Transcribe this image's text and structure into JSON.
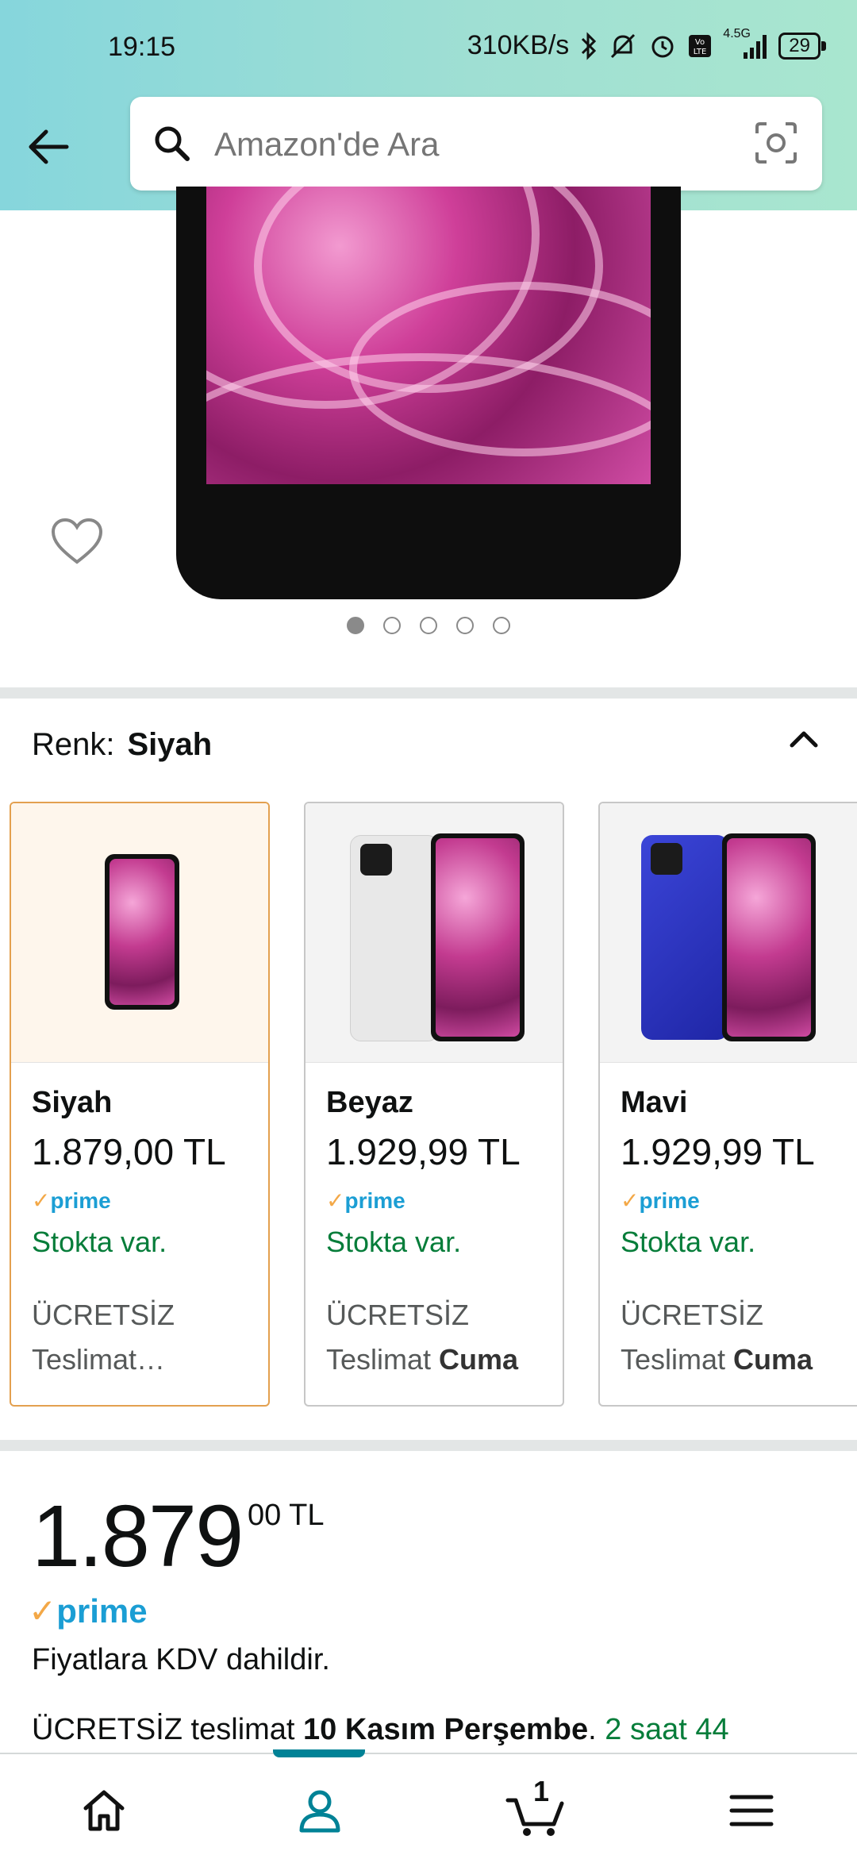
{
  "status_bar": {
    "time": "19:15",
    "network_speed": "310KB/s",
    "network_type": "4.5G",
    "battery": "29"
  },
  "search": {
    "placeholder": "Amazon'de Ara"
  },
  "gallery": {
    "image_count": 5,
    "active_index": 0
  },
  "color_selector": {
    "label": "Renk:",
    "selected": "Siyah",
    "options": [
      {
        "name": "Siyah",
        "price": "1.879,00 TL",
        "prime": "prime",
        "stock": "Stokta var.",
        "free": "ÜCRETSİZ",
        "delivery_prefix": "Teslimat…",
        "delivery_day": ""
      },
      {
        "name": "Beyaz",
        "price": "1.929,99 TL",
        "prime": "prime",
        "stock": "Stokta var.",
        "free": "ÜCRETSİZ",
        "delivery_prefix": "Teslimat",
        "delivery_day": "Cuma"
      },
      {
        "name": "Mavi",
        "price": "1.929,99 TL",
        "prime": "prime",
        "stock": "Stokta var.",
        "free": "ÜCRETSİZ",
        "delivery_prefix": "Teslimat",
        "delivery_day": "Cuma"
      }
    ]
  },
  "price": {
    "whole": "1.879",
    "fraction": "00",
    "currency": "TL",
    "prime": "prime",
    "vat_note": "Fiyatlara KDV dahildir.",
    "shipping_prefix": "ÜCRETSİZ teslimat",
    "shipping_date": "10 Kasım Perşembe",
    "shipping_time": "2 saat 44"
  },
  "bottom_nav": {
    "cart_count": "1",
    "items": [
      "home-icon",
      "account-icon",
      "cart-icon",
      "menu-icon"
    ]
  },
  "colors": {
    "header_from": "#86d6dc",
    "header_to": "#a9e6cf",
    "prime_blue": "#1b9ed4",
    "stock_green": "#067d3a",
    "selected_border": "#e3a04f",
    "nav_active": "#008296"
  }
}
